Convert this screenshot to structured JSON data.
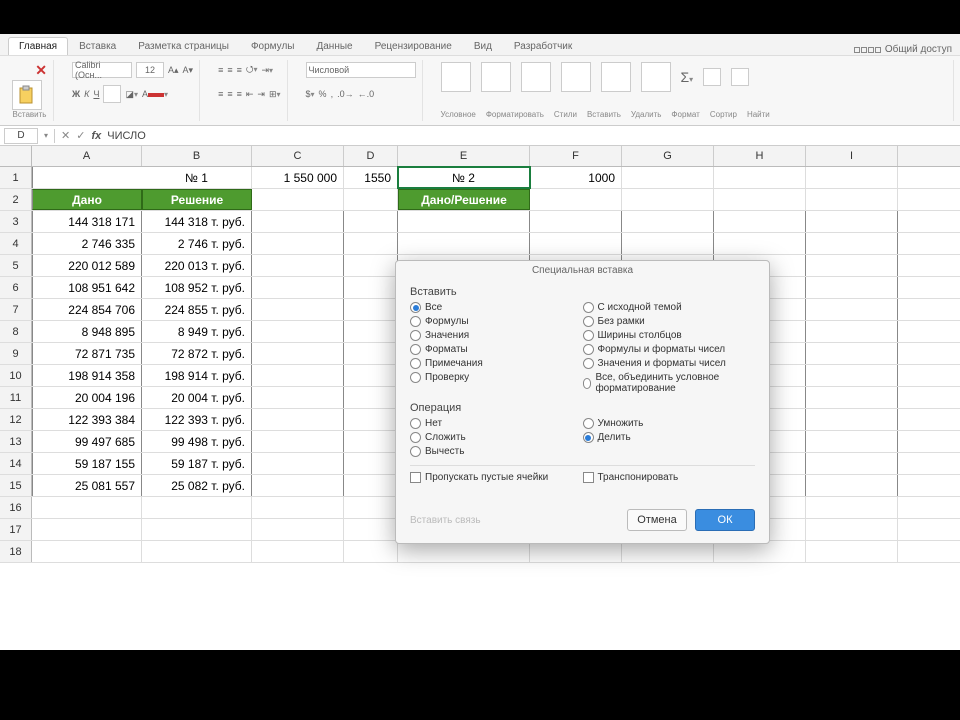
{
  "tabs": {
    "items": [
      "Главная",
      "Вставка",
      "Разметка страницы",
      "Формулы",
      "Данные",
      "Рецензирование",
      "Вид",
      "Разработчик"
    ],
    "active": 0,
    "right": "Общий доступ"
  },
  "ribbon": {
    "clipboard": "Вставить",
    "font_name": "Calibri (Осн...",
    "font_size": "12",
    "bold": "Ж",
    "italic": "К",
    "ul": "Ч",
    "number_format": "Числовой",
    "groups_right": [
      "Условное",
      "Форматировать",
      "Стили",
      "Вставить",
      "Удалить",
      "Формат",
      "Сортир",
      "Найти"
    ]
  },
  "formula_bar": {
    "name": "D",
    "fx": "fx",
    "formula": "ЧИСЛО"
  },
  "columns": [
    "A",
    "B",
    "C",
    "D",
    "E",
    "F",
    "G",
    "H",
    "I"
  ],
  "row_labels": [
    "1",
    "2",
    "3",
    "4",
    "5",
    "6",
    "7",
    "8",
    "9",
    "10",
    "11",
    "12",
    "13",
    "14",
    "15",
    "16",
    "17",
    "18"
  ],
  "row1": {
    "B": "№ 1",
    "C": "1 550 000",
    "D": "1550",
    "E": "№ 2",
    "F": "1000"
  },
  "row2": {
    "A": "Дано",
    "B": "Решение",
    "E": "Дано/Решение"
  },
  "table": [
    {
      "a": "144 318 171",
      "b": "144 318 т. руб."
    },
    {
      "a": "2 746 335",
      "b": "2 746 т. руб."
    },
    {
      "a": "220 012 589",
      "b": "220 013 т. руб."
    },
    {
      "a": "108 951 642",
      "b": "108 952 т. руб."
    },
    {
      "a": "224 854 706",
      "b": "224 855 т. руб."
    },
    {
      "a": "8 948 895",
      "b": "8 949 т. руб."
    },
    {
      "a": "72 871 735",
      "b": "72 872 т. руб."
    },
    {
      "a": "198 914 358",
      "b": "198 914 т. руб."
    },
    {
      "a": "20 004 196",
      "b": "20 004 т. руб."
    },
    {
      "a": "122 393 384",
      "b": "122 393 т. руб."
    },
    {
      "a": "99 497 685",
      "b": "99 498 т. руб."
    },
    {
      "a": "59 187 155",
      "b": "59 187 т. руб."
    },
    {
      "a": "25 081 557",
      "b": "25 082 т. руб."
    }
  ],
  "dialog": {
    "title": "Специальная вставка",
    "insert_label": "Вставить",
    "insert_left": [
      "Все",
      "Формулы",
      "Значения",
      "Форматы",
      "Примечания",
      "Проверку"
    ],
    "insert_right": [
      "С исходной темой",
      "Без рамки",
      "Ширины столбцов",
      "Формулы и форматы чисел",
      "Значения и форматы чисел",
      "Все, объединить условное форматирование"
    ],
    "insert_selected": 0,
    "op_label": "Операция",
    "op_left": [
      "Нет",
      "Сложить",
      "Вычесть"
    ],
    "op_right": [
      "Умножить",
      "Делить"
    ],
    "op_selected": "Делить",
    "skip": "Пропускать пустые ячейки",
    "transpose": "Транспонировать",
    "paste_link": "Вставить связь",
    "cancel": "Отмена",
    "ok": "ОК"
  }
}
